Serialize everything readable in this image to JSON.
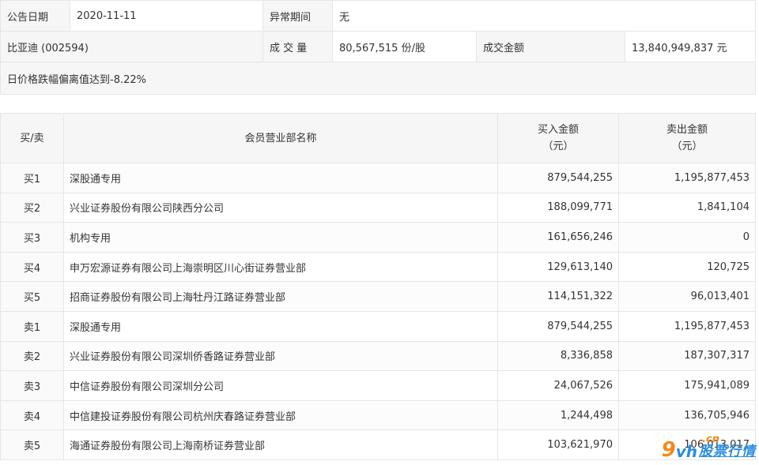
{
  "info": {
    "announce_date_label": "公告日期",
    "announce_date": "2020-11-11",
    "abnormal_period_label": "异常期间",
    "abnormal_period": "无",
    "stock_name": "比亚迪 (002594)",
    "volume_label": "成 交 量",
    "volume": "80,567,515 份/股",
    "turnover_label": "成交金额",
    "turnover": "13,840,949,837 元",
    "reason": "日价格跌幅偏离值达到-8.22%"
  },
  "table": {
    "headers": {
      "side": "买/卖",
      "member": "会员营业部名称",
      "buy_line1": "买入金额",
      "buy_line2": "（元）",
      "sell_line1": "卖出金额",
      "sell_line2": "（元）"
    },
    "rows": [
      {
        "side": "买1",
        "member": "深股通专用",
        "buy": "879,544,255",
        "sell": "1,195,877,453"
      },
      {
        "side": "买2",
        "member": "兴业证券股份有限公司陕西分公司",
        "buy": "188,099,771",
        "sell": "1,841,104"
      },
      {
        "side": "买3",
        "member": "机构专用",
        "buy": "161,656,246",
        "sell": "0"
      },
      {
        "side": "买4",
        "member": "申万宏源证券有限公司上海崇明区川心街证券营业部",
        "buy": "129,613,140",
        "sell": "120,725"
      },
      {
        "side": "买5",
        "member": "招商证券股份有限公司上海牡丹江路证券营业部",
        "buy": "114,151,322",
        "sell": "96,013,401"
      },
      {
        "side": "卖1",
        "member": "深股通专用",
        "buy": "879,544,255",
        "sell": "1,195,877,453"
      },
      {
        "side": "卖2",
        "member": "兴业证券股份有限公司深圳侨香路证券营业部",
        "buy": "8,336,858",
        "sell": "187,307,317"
      },
      {
        "side": "卖3",
        "member": "中信证券股份有限公司深圳分公司",
        "buy": "24,067,526",
        "sell": "175,941,089"
      },
      {
        "side": "卖4",
        "member": "中信建投证券股份有限公司杭州庆春路证券营业部",
        "buy": "1,244,498",
        "sell": "136,705,946"
      },
      {
        "side": "卖5",
        "member": "海通证券股份有限公司上海南桥证券营业部",
        "buy": "103,621,970",
        "sell": "106,013,017"
      }
    ]
  },
  "watermark": {
    "nine": "9",
    "vh": "vh",
    "cn": ".cn",
    "text": "股票行情"
  }
}
